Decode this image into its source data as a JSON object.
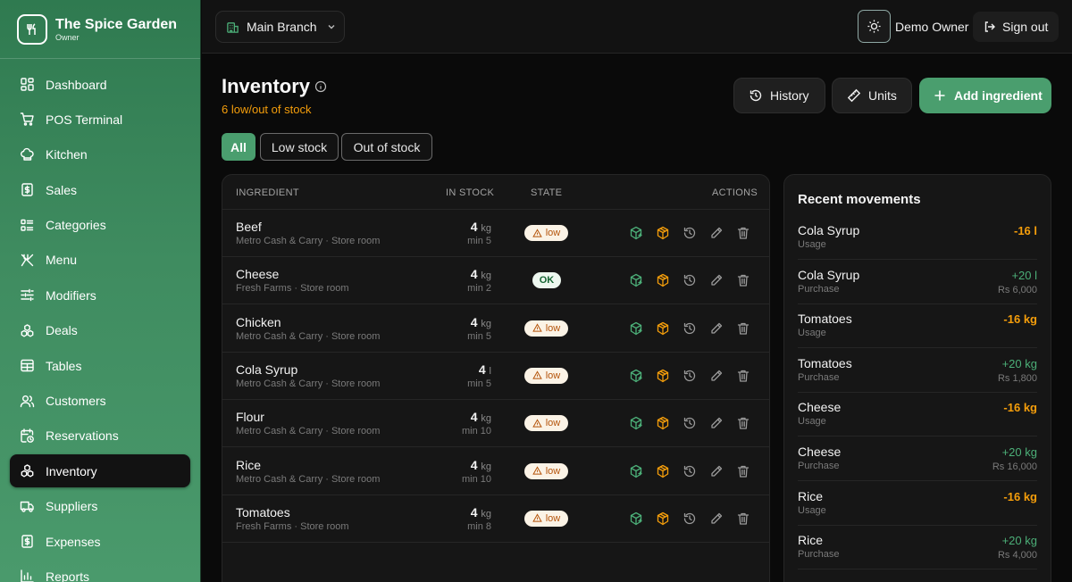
{
  "app": {
    "name": "The Spice Garden",
    "role": "Owner"
  },
  "sidebar": {
    "items": [
      {
        "label": "Dashboard",
        "icon": "dashboard-icon"
      },
      {
        "label": "POS Terminal",
        "icon": "cart-icon"
      },
      {
        "label": "Kitchen",
        "icon": "chef-hat-icon"
      },
      {
        "label": "Sales",
        "icon": "receipt-icon"
      },
      {
        "label": "Categories",
        "icon": "list-icon"
      },
      {
        "label": "Menu",
        "icon": "utensils-icon"
      },
      {
        "label": "Modifiers",
        "icon": "sliders-icon"
      },
      {
        "label": "Deals",
        "icon": "boxes-icon"
      },
      {
        "label": "Tables",
        "icon": "table-icon"
      },
      {
        "label": "Customers",
        "icon": "users-icon"
      },
      {
        "label": "Reservations",
        "icon": "calendar-clock-icon"
      },
      {
        "label": "Inventory",
        "icon": "boxes-icon",
        "active": true
      },
      {
        "label": "Suppliers",
        "icon": "truck-icon"
      },
      {
        "label": "Expenses",
        "icon": "receipt-icon"
      },
      {
        "label": "Reports",
        "icon": "bar-chart-icon"
      }
    ]
  },
  "topbar": {
    "branch": "Main Branch",
    "user": "Demo Owner",
    "signout": "Sign out"
  },
  "page": {
    "title": "Inventory",
    "subtitle": "6 low/out of stock",
    "history_label": "History",
    "units_label": "Units",
    "add_label": "Add ingredient"
  },
  "filters": {
    "all": "All",
    "low": "Low stock",
    "out": "Out of stock"
  },
  "table": {
    "headers": {
      "ingredient": "INGREDIENT",
      "stock": "IN STOCK",
      "state": "STATE",
      "actions": "ACTIONS"
    },
    "rows": [
      {
        "name": "Beef",
        "sub": "Metro Cash & Carry · Store room",
        "qty": "4",
        "unit": "kg",
        "min": "min 5",
        "state": "low"
      },
      {
        "name": "Cheese",
        "sub": "Fresh Farms · Store room",
        "qty": "4",
        "unit": "kg",
        "min": "min 2",
        "state": "OK"
      },
      {
        "name": "Chicken",
        "sub": "Metro Cash & Carry · Store room",
        "qty": "4",
        "unit": "kg",
        "min": "min 5",
        "state": "low"
      },
      {
        "name": "Cola Syrup",
        "sub": "Metro Cash & Carry · Store room",
        "qty": "4",
        "unit": "l",
        "min": "min 5",
        "state": "low"
      },
      {
        "name": "Flour",
        "sub": "Metro Cash & Carry · Store room",
        "qty": "4",
        "unit": "kg",
        "min": "min 10",
        "state": "low"
      },
      {
        "name": "Rice",
        "sub": "Metro Cash & Carry · Store room",
        "qty": "4",
        "unit": "kg",
        "min": "min 10",
        "state": "low"
      },
      {
        "name": "Tomatoes",
        "sub": "Fresh Farms · Store room",
        "qty": "4",
        "unit": "kg",
        "min": "min 8",
        "state": "low"
      }
    ]
  },
  "movements": {
    "title": "Recent movements",
    "items": [
      {
        "name": "Cola Syrup",
        "type": "Usage",
        "qty": "-16 l",
        "cost": ""
      },
      {
        "name": "Cola Syrup",
        "type": "Purchase",
        "qty": "+20 l",
        "cost": "Rs 6,000"
      },
      {
        "name": "Tomatoes",
        "type": "Usage",
        "qty": "-16 kg",
        "cost": ""
      },
      {
        "name": "Tomatoes",
        "type": "Purchase",
        "qty": "+20 kg",
        "cost": "Rs 1,800"
      },
      {
        "name": "Cheese",
        "type": "Usage",
        "qty": "-16 kg",
        "cost": ""
      },
      {
        "name": "Cheese",
        "type": "Purchase",
        "qty": "+20 kg",
        "cost": "Rs 16,000"
      },
      {
        "name": "Rice",
        "type": "Usage",
        "qty": "-16 kg",
        "cost": ""
      },
      {
        "name": "Rice",
        "type": "Purchase",
        "qty": "+20 kg",
        "cost": "Rs 4,000"
      }
    ]
  },
  "colors": {
    "accent": "#4a9e6e",
    "warning": "#f59e0b",
    "positive": "#4caf78"
  }
}
